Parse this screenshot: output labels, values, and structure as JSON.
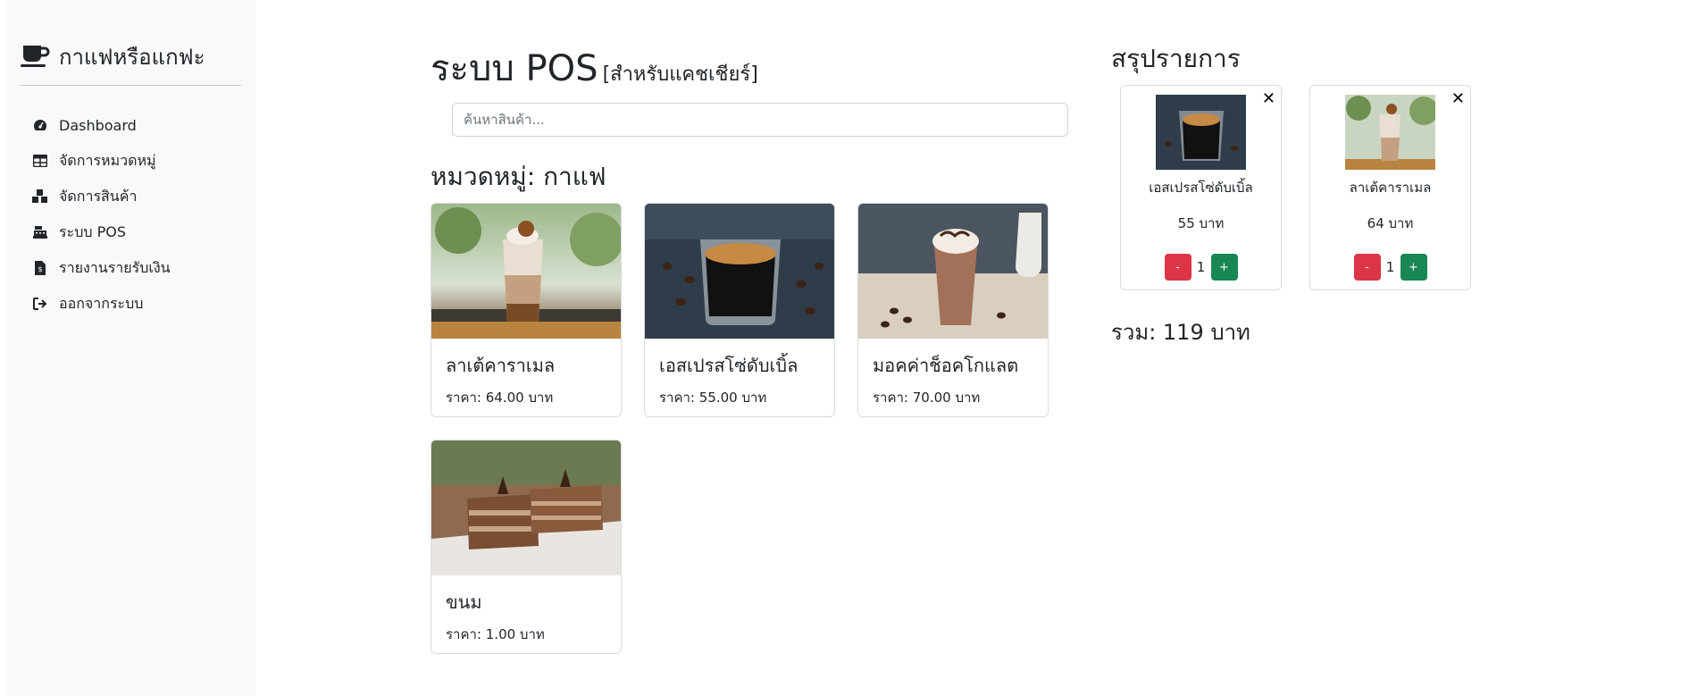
{
  "sidebar": {
    "brand": "กาแฟหรือแกฟะ",
    "items": [
      {
        "label": "Dashboard",
        "icon": "dashboard-gauge-icon"
      },
      {
        "label": "จัดการหมวดหมู่",
        "icon": "table-icon"
      },
      {
        "label": "จัดการสินค้า",
        "icon": "boxes-icon"
      },
      {
        "label": "ระบบ POS",
        "icon": "cash-register-icon"
      },
      {
        "label": "รายงานรายรับเงิน",
        "icon": "file-invoice-icon"
      },
      {
        "label": "ออกจากระบบ",
        "icon": "sign-out-icon"
      }
    ]
  },
  "main": {
    "title": "ระบบ POS",
    "subtitle": "[สำหรับแคชเชียร์]",
    "search_placeholder": "ค้นหาสินค้า...",
    "category_title": "หมวดหมู่: กาแฟ",
    "products": [
      {
        "name": "ลาเต้คาราเมล",
        "price": "ราคา: 64.00 บาท",
        "image": "caramel-latte-photo"
      },
      {
        "name": "เอสเปรสโซ่ดับเบิ้ล",
        "price": "ราคา: 55.00 บาท",
        "image": "espresso-double-photo"
      },
      {
        "name": "มอคค่าช็อคโกแลต",
        "price": "ราคา: 70.00 บาท",
        "image": "mocha-chocolate-photo"
      },
      {
        "name": "ขนม",
        "price": "ราคา: 1.00 บาท",
        "image": "chocolate-cake-photo"
      }
    ]
  },
  "summary": {
    "title": "สรุปรายการ",
    "items": [
      {
        "name": "เอสเปรสโซ่ดับเบิ้ล",
        "price": "55 บาท",
        "qty": "1",
        "minus": "-",
        "plus": "+",
        "close": "✕"
      },
      {
        "name": "ลาเต้คาราเมล",
        "price": "64 บาท",
        "qty": "1",
        "minus": "-",
        "plus": "+",
        "close": "✕"
      }
    ],
    "total": "รวม: 119 บาท"
  },
  "colors": {
    "sidebar_bg": "#f8f9fa",
    "danger": "#dc3545",
    "success": "#198754",
    "text": "#212529"
  }
}
